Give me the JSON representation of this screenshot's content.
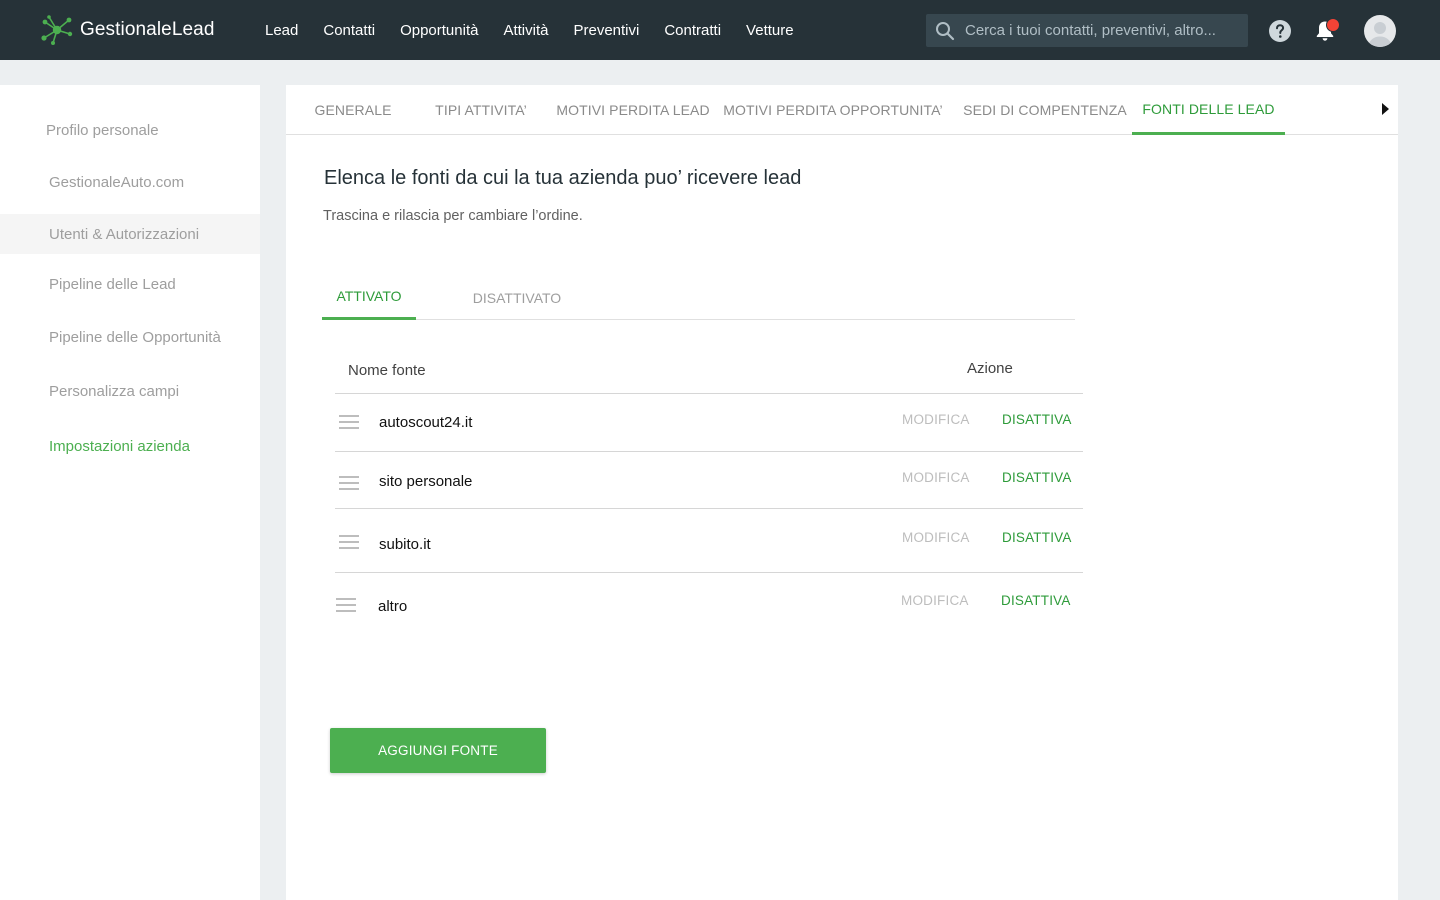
{
  "app": {
    "name": "GestionaleLead",
    "accent": "#4caf50",
    "topbar_bg": "#263238"
  },
  "nav": [
    {
      "label": "Lead"
    },
    {
      "label": "Contatti"
    },
    {
      "label": "Opportunità"
    },
    {
      "label": "Attività"
    },
    {
      "label": "Preventivi"
    },
    {
      "label": "Contratti"
    },
    {
      "label": "Vetture"
    }
  ],
  "search": {
    "placeholder": "Cerca i tuoi contatti, preventivi, altro..."
  },
  "header_icons": [
    "help-icon",
    "bell-icon",
    "avatar"
  ],
  "sidebar": {
    "items": [
      {
        "label": "Profilo personale"
      },
      {
        "label": "GestionaleAuto.com"
      },
      {
        "label": "Utenti & Autorizzazioni"
      },
      {
        "label": "Pipeline delle Lead"
      },
      {
        "label": "Pipeline delle Opportunità"
      },
      {
        "label": "Personalizza campi"
      },
      {
        "label": "Impostazioni azienda"
      }
    ],
    "selected": "Impostazioni azienda"
  },
  "tabs": [
    {
      "label": "GENERALE"
    },
    {
      "label": "TIPI ATTIVITA’"
    },
    {
      "label": "MOTIVI PERDITA LEAD"
    },
    {
      "label": "MOTIVI PERDITA OPPORTUNITA’"
    },
    {
      "label": "SEDI DI COMPENTENZA"
    },
    {
      "label": "FONTI DELLE LEAD"
    }
  ],
  "active_tab": "FONTI DELLE LEAD",
  "content": {
    "title": "Elenca le fonti da cui la tua azienda puo’ ricevere lead",
    "subtitle": "Trascina e rilascia per cambiare l’ordine.",
    "subtabs": [
      {
        "label": "ATTIVATO"
      },
      {
        "label": "DISATTIVATO"
      }
    ],
    "active_subtab": "ATTIVATO",
    "table": {
      "col_name": "Nome fonte",
      "col_action": "Azione",
      "rows": [
        {
          "name": "autoscout24.it",
          "edit": "MODIFICA",
          "deactivate": "DISATTIVA"
        },
        {
          "name": "sito personale",
          "edit": "MODIFICA",
          "deactivate": "DISATTIVA"
        },
        {
          "name": "subito.it",
          "edit": "MODIFICA",
          "deactivate": "DISATTIVA"
        },
        {
          "name": "altro",
          "edit": "MODIFICA",
          "deactivate": "DISATTIVA"
        }
      ]
    },
    "add_button": "AGGIUNGI FONTE"
  }
}
